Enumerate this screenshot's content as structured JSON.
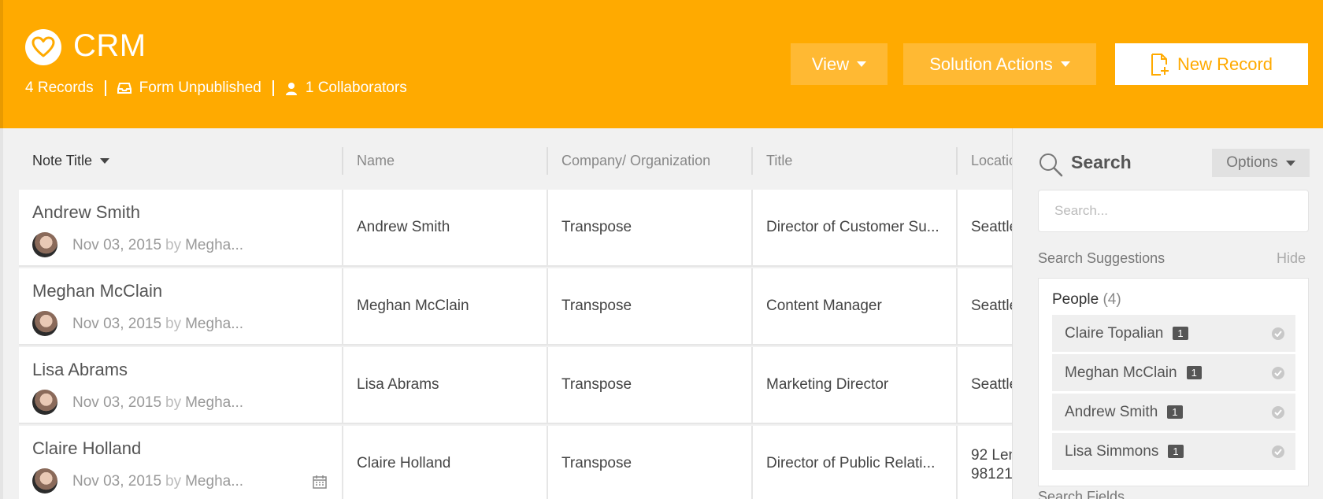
{
  "header": {
    "app_title": "CRM",
    "records": "4 Records",
    "form_status": "Form Unpublished",
    "collaborators": "1 Collaborators",
    "view_label": "View",
    "actions_label": "Solution Actions",
    "new_record_label": "New Record",
    "accent_color": "#ffaa00"
  },
  "table": {
    "columns": [
      "Note Title",
      "Name",
      "Company/ Organization",
      "Title",
      "Location"
    ],
    "rows": [
      {
        "note_title": "Andrew Smith",
        "date": "Nov 03, 2015",
        "by": "by",
        "author": "Megha...",
        "name": "Andrew Smith",
        "company": "Transpose",
        "title": "Director of Customer Su...",
        "location": "Seattle"
      },
      {
        "note_title": "Meghan McClain",
        "date": "Nov 03, 2015",
        "by": "by",
        "author": "Megha...",
        "name": "Meghan McClain",
        "company": "Transpose",
        "title": "Content Manager",
        "location": "Seattle"
      },
      {
        "note_title": "Lisa Abrams",
        "date": "Nov 03, 2015",
        "by": "by",
        "author": "Megha...",
        "name": "Lisa Abrams",
        "company": "Transpose",
        "title": "Marketing Director",
        "location": "Seattle"
      },
      {
        "note_title": "Claire Holland",
        "date": "Nov 03, 2015",
        "by": "by",
        "author": "Megha...",
        "name": "Claire Holland",
        "company": "Transpose",
        "title": "Director of Public Relati...",
        "location_line1": "92 Len",
        "location_line2": "98121"
      }
    ]
  },
  "side": {
    "search_label": "Search",
    "options_label": "Options",
    "search_placeholder": "Search...",
    "suggestions_title": "Search Suggestions",
    "hide_label": "Hide",
    "people_label": "People",
    "people_count": "(4)",
    "people": [
      {
        "name": "Claire Topalian",
        "badge": "1"
      },
      {
        "name": "Meghan McClain",
        "badge": "1"
      },
      {
        "name": "Andrew Smith",
        "badge": "1"
      },
      {
        "name": "Lisa Simmons",
        "badge": "1"
      }
    ],
    "bottom_label": "Search Fields"
  }
}
